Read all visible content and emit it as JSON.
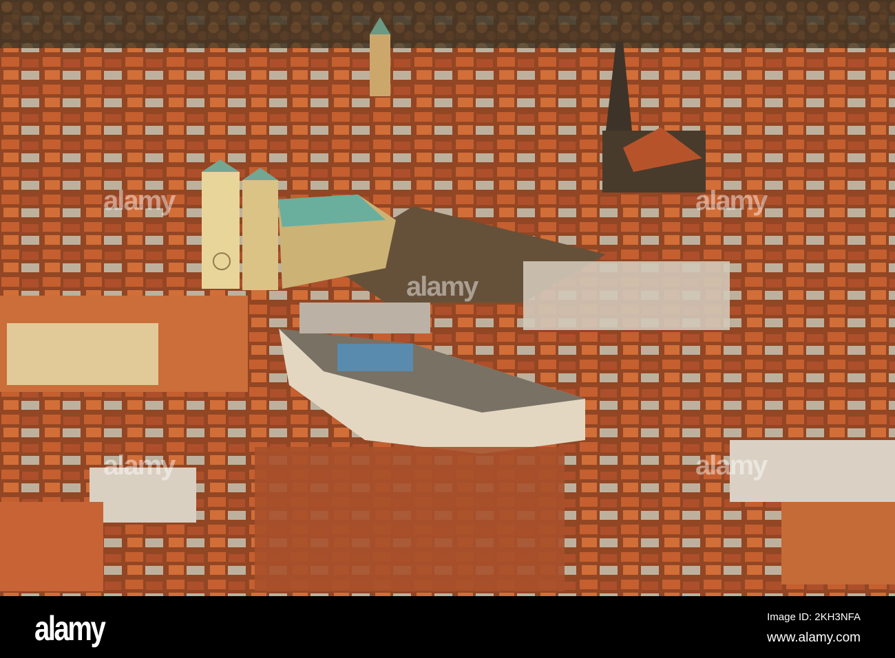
{
  "watermark": "alamy",
  "footer": {
    "logo": "alamy",
    "image_id": "Image ID: 2KH3NFA",
    "website": "www.alamy.com"
  },
  "colors": {
    "roof": "#b5532c",
    "sky_shadow": "#2a2622",
    "cathedral": "#e6d6a0",
    "copper": "#5fa8a0"
  }
}
